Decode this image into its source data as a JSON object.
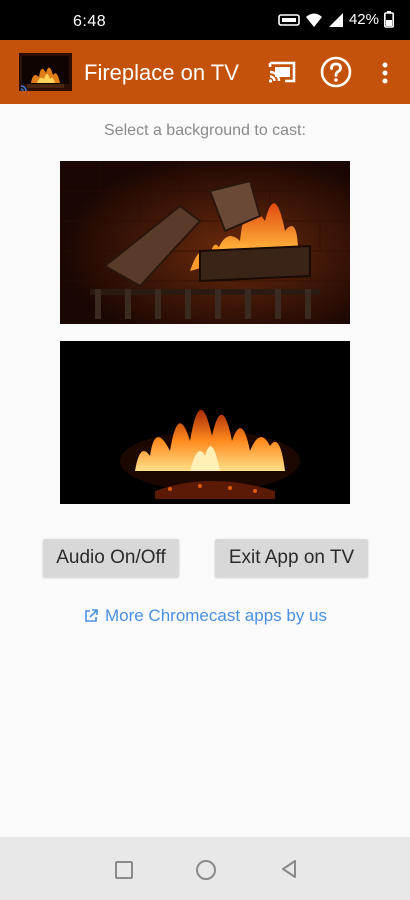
{
  "status": {
    "time": "6:48",
    "battery": "42%",
    "icons": [
      "volte-icon",
      "wifi-icon",
      "signal-icon",
      "battery-icon"
    ]
  },
  "appbar": {
    "title": "Fireplace on TV",
    "color": "#c5520a",
    "actions": [
      "cast-icon",
      "help-icon",
      "more-vert-icon"
    ]
  },
  "main": {
    "prompt": "Select a background to cast:",
    "backgrounds": [
      {
        "name": "fireplace-logs"
      },
      {
        "name": "fireplace-dark"
      }
    ],
    "buttons": {
      "audio": "Audio On/Off",
      "exit": "Exit App on TV"
    },
    "more_link": "More Chromecast apps by us",
    "link_color": "#4a90e2"
  },
  "navbar": {
    "icons": [
      "recents-icon",
      "home-icon",
      "back-icon"
    ]
  }
}
